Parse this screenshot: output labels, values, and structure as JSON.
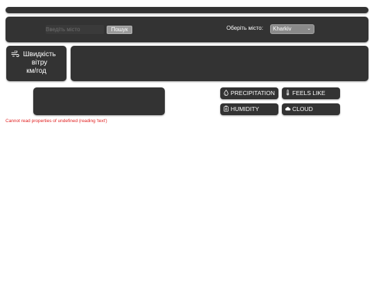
{
  "search": {
    "placeholder": "Введіть місто",
    "button_label": "Пошук"
  },
  "city_select": {
    "label": "Оберіть місто:",
    "selected": "Kharkiv"
  },
  "wind": {
    "label": "Швидкість вітру",
    "unit": "км/год",
    "icon": "wind-icon"
  },
  "metrics": [
    {
      "label": "PRECIPITATION",
      "icon": "droplet-icon"
    },
    {
      "label": "FEELS LIKE",
      "icon": "thermometer-icon"
    },
    {
      "label": "HUMIDITY",
      "icon": "humidity-icon"
    },
    {
      "label": "CLOUD",
      "icon": "cloud-icon"
    }
  ],
  "error": {
    "message": "Cannot read properties of undefined (reading 'text')"
  },
  "colors": {
    "panel": "#333333",
    "error": "#e01b1b",
    "button": "#9a9a9a"
  }
}
